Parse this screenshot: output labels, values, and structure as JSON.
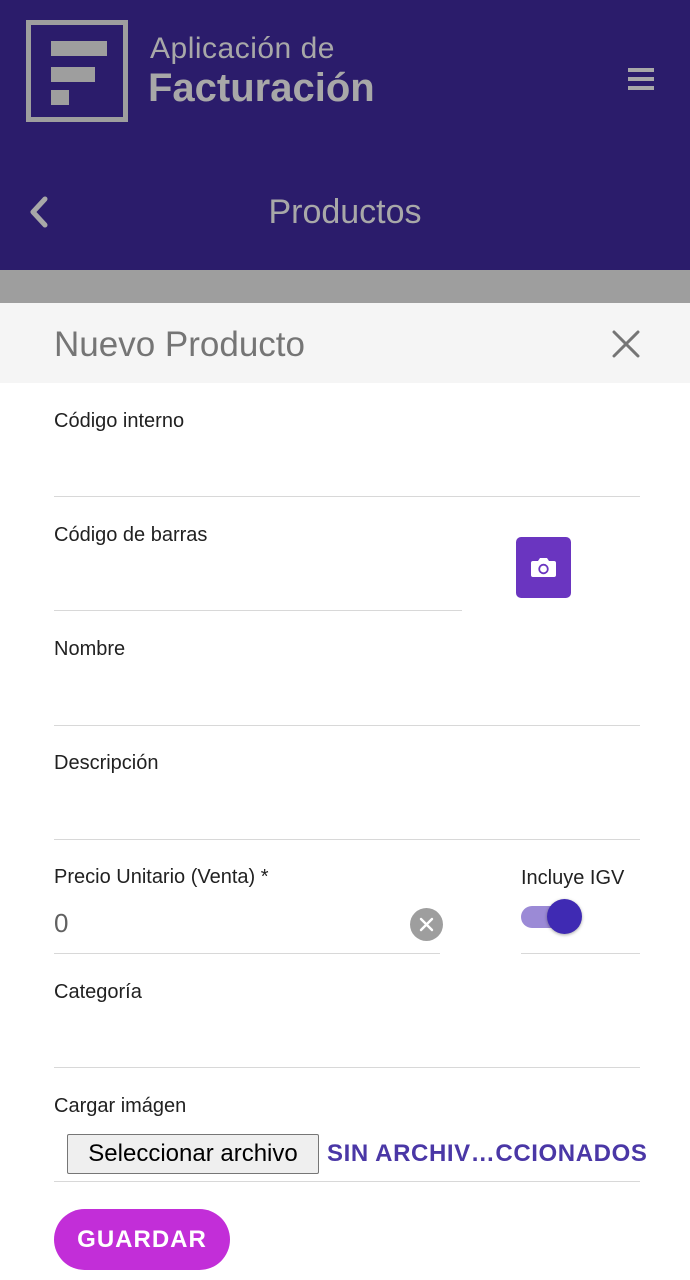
{
  "app": {
    "title_line1": "Aplicación de",
    "title_line2": "Facturación",
    "logo_icon": "f-logo-icon",
    "menu_icon": "hamburger-icon"
  },
  "nav": {
    "back_icon": "chevron-left-icon",
    "page_title": "Productos"
  },
  "modal": {
    "title": "Nuevo Producto",
    "close_icon": "close-icon"
  },
  "form": {
    "codigo_interno": {
      "label": "Código interno",
      "value": ""
    },
    "codigo_barras": {
      "label": "Código de barras",
      "value": "",
      "scan_icon": "camera-icon"
    },
    "nombre": {
      "label": "Nombre",
      "value": ""
    },
    "descripcion": {
      "label": "Descripción",
      "value": ""
    },
    "precio": {
      "label": "Precio Unitario (Venta) *",
      "value": "0",
      "clear_icon": "clear-circle-icon"
    },
    "igv": {
      "label": "Incluye IGV",
      "checked": true
    },
    "categoria": {
      "label": "Categoría",
      "value": ""
    },
    "imagen": {
      "label": "Cargar imágen",
      "file_button": "Seleccionar archivo",
      "file_status": "SIN ARCHIV…CCIONADOS"
    },
    "save_label": "GUARDAR"
  },
  "colors": {
    "header_bg": "#2b1c6b",
    "accent": "#6a35c0",
    "save_button": "#c22ed8",
    "toggle": "#3f2ab3"
  }
}
